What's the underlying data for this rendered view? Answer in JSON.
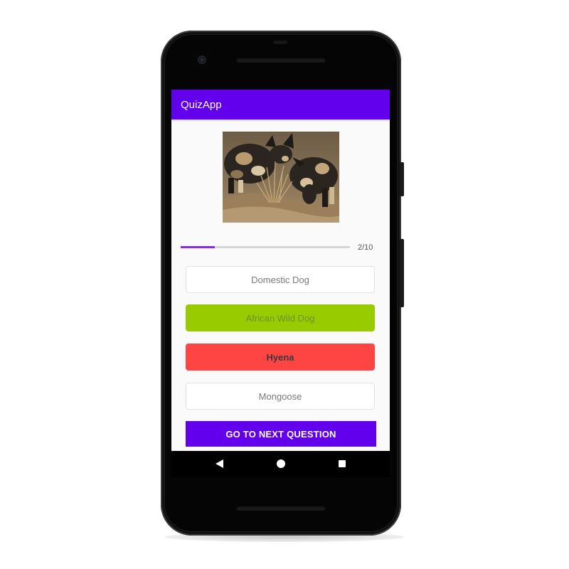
{
  "app": {
    "title": "QuizApp"
  },
  "question": {
    "image": "african-wild-dog-pups-photo",
    "progress_text": "2/10",
    "progress_fraction": 0.2
  },
  "options": [
    {
      "label": "Domestic Dog",
      "state": "default"
    },
    {
      "label": "African Wild Dog",
      "state": "correct"
    },
    {
      "label": "Hyena",
      "state": "wrong-selected"
    },
    {
      "label": "Mongoose",
      "state": "default"
    }
  ],
  "actions": {
    "next_label": "GO TO NEXT QUESTION"
  },
  "navbar": {
    "back_icon": "back-triangle-icon",
    "home_icon": "home-circle-icon",
    "recent_icon": "recent-apps-square-icon"
  },
  "colors": {
    "primary": "#6200ee",
    "correct": "#99cc00",
    "wrong": "#ff4444",
    "progress": "#8a2be2"
  }
}
